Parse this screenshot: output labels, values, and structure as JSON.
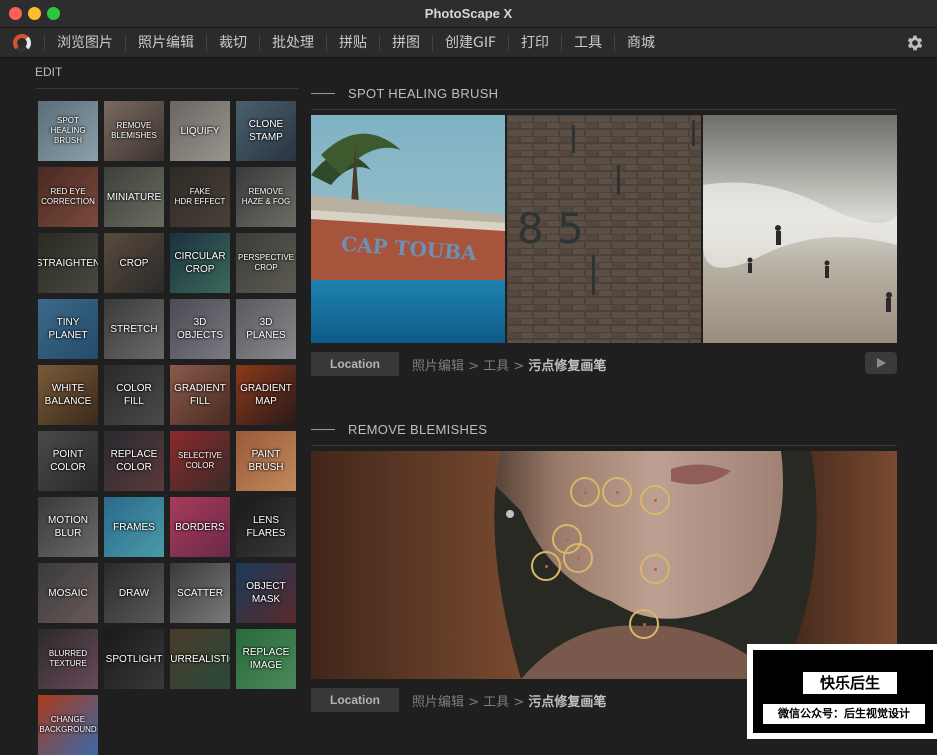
{
  "app": {
    "title": "PhotoScape X"
  },
  "menu": [
    "浏览图片",
    "照片编辑",
    "裁切",
    "批处理",
    "拼贴",
    "拼图",
    "创建GIF",
    "打印",
    "工具",
    "商城"
  ],
  "sidebar": {
    "header": "EDIT",
    "tools": [
      "SPOT\nHEALING\nBRUSH",
      "REMOVE\nBLEMISHES",
      "LIQUIFY",
      "CLONE\nSTAMP",
      "RED EYE\nCORRECTION",
      "MINIATURE",
      "FAKE\nHDR EFFECT",
      "REMOVE\nHAZE & FOG",
      "STRAIGHTEN",
      "CROP",
      "CIRCULAR\nCROP",
      "PERSPECTIVE\nCROP",
      "TINY\nPLANET",
      "STRETCH",
      "3D\nOBJECTS",
      "3D\nPLANES",
      "WHITE\nBALANCE",
      "COLOR\nFILL",
      "GRADIENT\nFILL",
      "GRADIENT\nMAP",
      "POINT\nCOLOR",
      "REPLACE\nCOLOR",
      "SELECTIVE\nCOLOR",
      "PAINT\nBRUSH",
      "MOTION\nBLUR",
      "FRAMES",
      "BORDERS",
      "LENS\nFLARES",
      "MOSAIC",
      "DRAW",
      "SCATTER",
      "OBJECT\nMASK",
      "BLURRED\nTEXTURE",
      "SPOTLIGHT",
      "SURREALISTIC",
      "REPLACE\nIMAGE",
      "CHANGE\nBACKGROUND"
    ]
  },
  "sections": [
    {
      "title": "SPOT HEALING BRUSH",
      "location_label": "Location",
      "path": "照片编辑 > 工具 > ",
      "path_bold": "污点修复画笔",
      "image_text": {
        "boat": "CAP TOUBA",
        "wall": "8   5"
      }
    },
    {
      "title": "REMOVE BLEMISHES",
      "location_label": "Location",
      "path": "照片编辑 > 工具 > ",
      "path_bold": "污点修复画笔"
    }
  ],
  "watermark": {
    "title": "快乐后生",
    "subtitle": "微信公众号：后生视觉设计"
  },
  "colors": {
    "background": "#1f1f1f",
    "titlebar": "#2d2d2d",
    "accent_circle": "#d9b76a"
  }
}
